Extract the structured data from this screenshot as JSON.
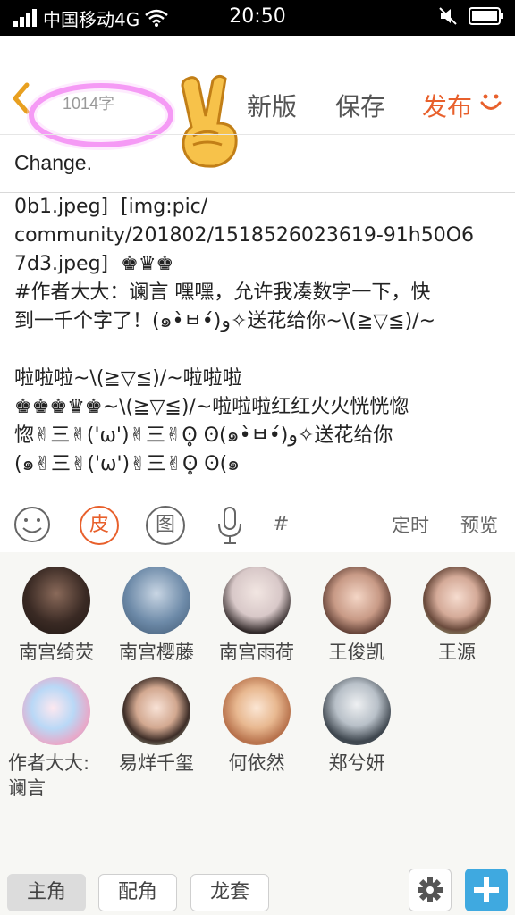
{
  "status_bar": {
    "carrier": "中国移动4G",
    "time": "20:50"
  },
  "header": {
    "char_count": "1014字",
    "new_version": "新版",
    "save": "保存",
    "publish": "发布"
  },
  "title": "Change.",
  "body_lines": [
    "0b1.jpeg]  [img:pic/",
    "community/201802/1518526023619-91h50O6",
    "7d3.jpeg]  ♚♛♚",
    "#作者大大：谰言 嘿嘿，允许我凑数字一下，快",
    "到一千个字了！(๑•̀ㅂ•́)و✧送花给你~\\(≧▽≦)/~",
    "",
    "啦啦啦~\\(≧▽≦)/~啦啦啦",
    "♚♚♚♛♚~\\(≧▽≦)/~啦啦啦红红火火恍恍惚",
    "惚✌三✌('ω')✌三✌ʘ̥ ʘ(๑•̀ㅂ•́)و✧送花给你",
    "(๑✌三✌('ω')✌三✌ʘ̥ ʘ(๑"
  ],
  "toolbar": {
    "skin_label": "皮",
    "image_label": "图",
    "hash": "#",
    "timer": "定时",
    "preview": "预览"
  },
  "characters": [
    {
      "name": "南宫绮荧"
    },
    {
      "name": "南宫樱藤"
    },
    {
      "name": "南宫雨荷"
    },
    {
      "name": "王俊凯"
    },
    {
      "name": "王源"
    },
    {
      "name": "作者大大:\n谰言"
    },
    {
      "name": "易烊千玺"
    },
    {
      "name": "何依然"
    },
    {
      "name": "郑兮妍"
    }
  ],
  "bottom_tabs": {
    "lead": "主角",
    "support": "配角",
    "extra": "龙套"
  },
  "colors": {
    "accent": "#e8602c",
    "plus_button": "#3fa9e0",
    "highlight": "#f06cf0"
  }
}
